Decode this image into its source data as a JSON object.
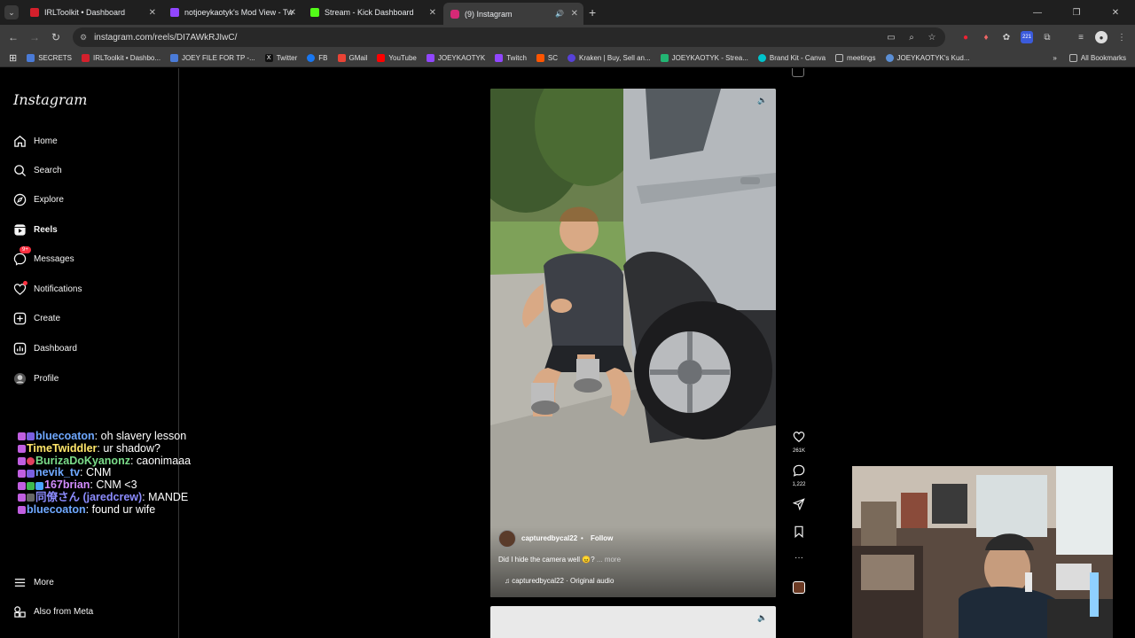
{
  "browser": {
    "tabs": [
      {
        "title": "IRLToolkit • Dashboard",
        "favicon_color": "#d4202c"
      },
      {
        "title": "notjoeykaotyk's Mod View - Tw",
        "favicon_color": "#9146ff"
      },
      {
        "title": "Stream - Kick Dashboard",
        "favicon_color": "#53fc18"
      },
      {
        "title": "(9) Instagram",
        "favicon_color": "#d62976"
      }
    ],
    "new_tab_label": "+",
    "url": "instagram.com/reels/DI7AWkRJIwC/",
    "bookmarks": [
      {
        "label": "SECRETS",
        "color": "#4a7bd8"
      },
      {
        "label": "IRLToolkit • Dashbo...",
        "color": "#d4202c"
      },
      {
        "label": "JOEY FILE FOR TP -...",
        "color": "#4a7bd8"
      },
      {
        "label": "Twitter",
        "color": "#222222"
      },
      {
        "label": "FB",
        "color": "#1877f2"
      },
      {
        "label": "GMail",
        "color": "#ea4335"
      },
      {
        "label": "YouTube",
        "color": "#ff0000"
      },
      {
        "label": "JOEYKAOTYK",
        "color": "#9146ff"
      },
      {
        "label": "Twitch",
        "color": "#9146ff"
      },
      {
        "label": "SC",
        "color": "#ff5500"
      },
      {
        "label": "Kraken | Buy, Sell an...",
        "color": "#5741d9"
      },
      {
        "label": "JOEYKAOTYK - Strea...",
        "color": "#22b573"
      },
      {
        "label": "Brand Kit - Canva",
        "color": "#00c4cc"
      },
      {
        "label": "meetings",
        "color": "#888888"
      },
      {
        "label": "JOEYKAOTYK's Kud...",
        "color": "#5b8fd6"
      }
    ],
    "all_bookmarks_label": "All Bookmarks",
    "extension_badge": "221"
  },
  "instagram": {
    "logo": "Instagram",
    "nav": [
      {
        "label": "Home",
        "icon": "home-icon"
      },
      {
        "label": "Search",
        "icon": "search-icon"
      },
      {
        "label": "Explore",
        "icon": "compass-icon"
      },
      {
        "label": "Reels",
        "icon": "reels-icon"
      },
      {
        "label": "Messages",
        "icon": "messenger-icon",
        "badge": "9+"
      },
      {
        "label": "Notifications",
        "icon": "heart-icon"
      },
      {
        "label": "Create",
        "icon": "plus-square-icon"
      },
      {
        "label": "Dashboard",
        "icon": "dashboard-icon"
      },
      {
        "label": "Profile",
        "icon": "avatar"
      }
    ],
    "more_label": "More",
    "also_meta_label": "Also from Meta",
    "reel": {
      "username": "capturedbycal22",
      "separator": "•",
      "follow_label": "Follow",
      "description": "Did I hide the camera well 😠?",
      "more_label": "... more",
      "audio": "♫ capturedbycal22 · Original audio",
      "likes": "261K",
      "comments": "1,222"
    }
  },
  "chat": [
    {
      "user": "bluecoaton",
      "message": ": oh slavery lesson",
      "color": "#6fa8ff"
    },
    {
      "user": "TimeTwiddler",
      "message": ": ur shadow?",
      "color": "#ffe66a"
    },
    {
      "user": "BurizaDoKyanonz",
      "message": ": caonimaaa",
      "color": "#7bdc8a"
    },
    {
      "user": "nevik_tv",
      "message": ": CNM",
      "color": "#6fa8ff"
    },
    {
      "user": "167brian",
      "message": ": CNM <3",
      "color": "#d38cff"
    },
    {
      "user": "同僚さん (jaredcrew)",
      "message": ": MANDE",
      "color": "#8c8cff"
    },
    {
      "user": "bluecoaton",
      "message": ": found ur wife",
      "color": "#6fa8ff"
    }
  ]
}
